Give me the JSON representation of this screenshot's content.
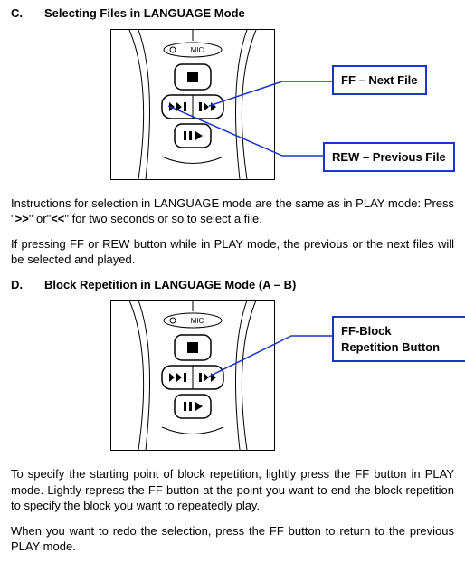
{
  "sectionC": {
    "letter": "C.",
    "title": "Selecting Files in LANGUAGE Mode",
    "callout1": "FF – Next File",
    "callout2": "REW – Previous File",
    "micLabel": "MIC",
    "instr1_a": "Instructions for selection in LANGUAGE mode are the same as in PLAY mode: Press \"",
    "instr1_b": "\" or\"",
    "instr1_c": "\" for two seconds or so to select a file.",
    "sym_ff": ">>",
    "sym_rew": "<<",
    "instr2": "If pressing FF or REW button while in PLAY mode, the previous or the next files will be selected and played."
  },
  "sectionD": {
    "letter": "D.",
    "title": "Block Repetition in LANGUAGE Mode (A – B)",
    "callout1_l1": "FF-Block",
    "callout1_l2": "Repetition Button",
    "micLabel": "MIC",
    "instr1": "To specify the starting point of block repetition, lightly press the FF button in PLAY mode. Lightly repress the FF button at the point you want to end the block repetition to specify the block you want to repeatedly play.",
    "instr2": "When you want to redo the selection, press the FF button to return to the previous PLAY mode."
  }
}
